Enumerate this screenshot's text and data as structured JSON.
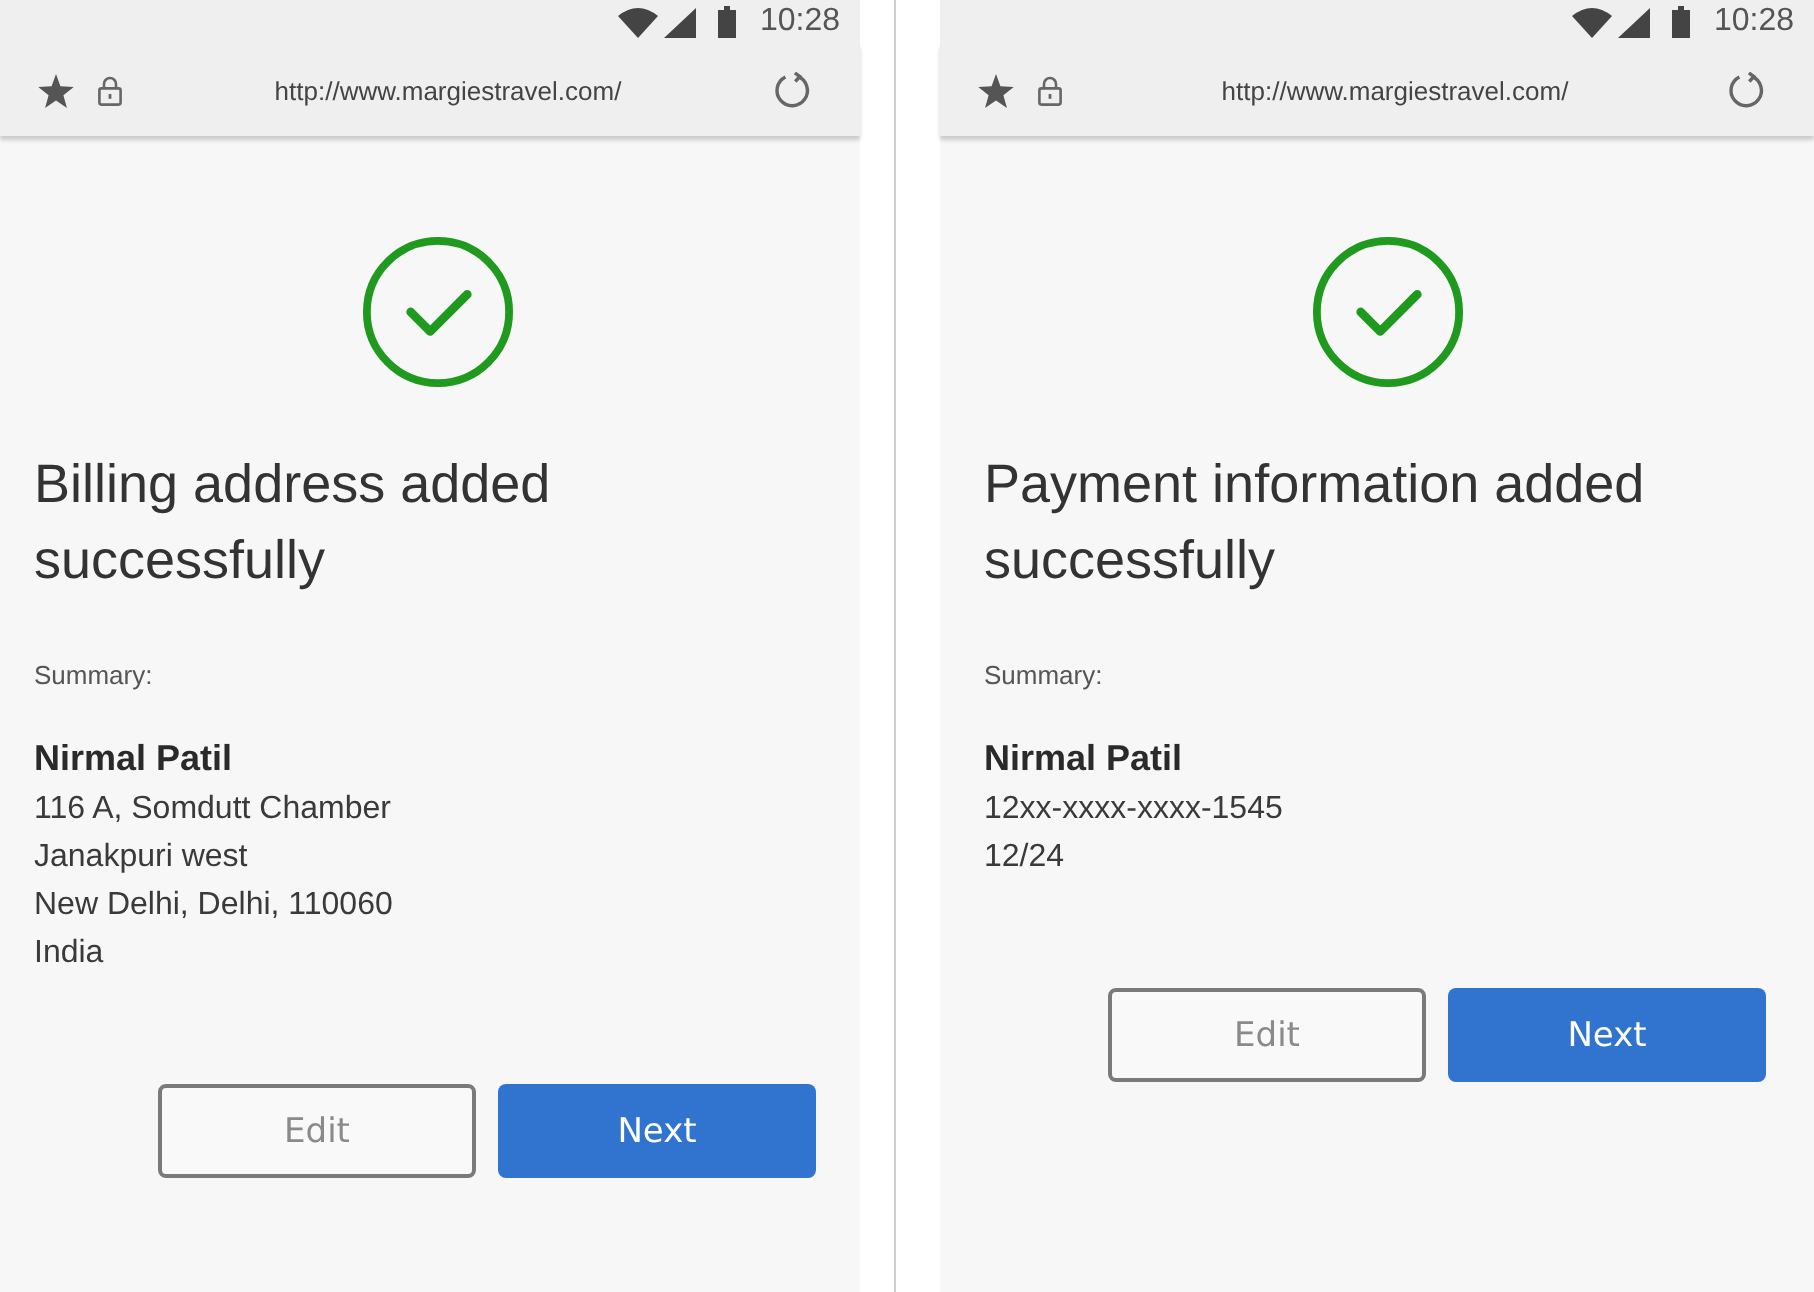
{
  "screens": [
    {
      "status_bar": {
        "time": "10:28"
      },
      "address_bar": {
        "url": "http://www.margiestravel.com/"
      },
      "title": "Billing address added successfully",
      "summary_label": "Summary:",
      "name": "Nirmal Patil",
      "details": [
        "116 A, Somdutt Chamber",
        "Janakpuri west",
        "New Delhi, Delhi, 110060",
        "India"
      ],
      "buttons": [
        {
          "label": "Edit",
          "kind": "secondary"
        },
        {
          "label": "Next",
          "kind": "primary"
        }
      ]
    },
    {
      "status_bar": {
        "time": "10:28"
      },
      "address_bar": {
        "url": "http://www.margiestravel.com/"
      },
      "title": "Payment information added successfully",
      "summary_label": "Summary:",
      "name": "Nirmal Patil",
      "details": [
        "12xx-xxxx-xxxx-1545",
        "12/24"
      ],
      "buttons": [
        {
          "label": "Edit",
          "kind": "secondary"
        },
        {
          "label": "Next",
          "kind": "primary"
        }
      ]
    }
  ]
}
